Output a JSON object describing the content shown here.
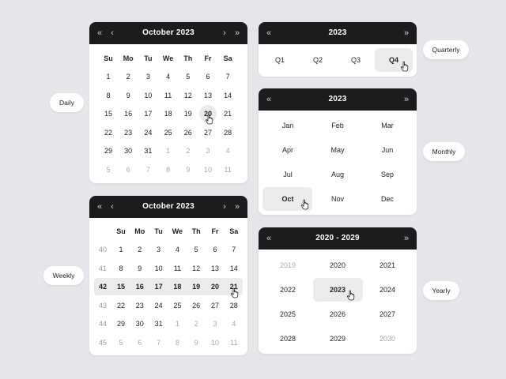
{
  "daily": {
    "title": "October 2023",
    "weekdays": [
      "Su",
      "Mo",
      "Tu",
      "We",
      "Th",
      "Fr",
      "Sa"
    ],
    "rows": [
      [
        {
          "d": "1"
        },
        {
          "d": "2"
        },
        {
          "d": "3"
        },
        {
          "d": "4"
        },
        {
          "d": "5"
        },
        {
          "d": "6"
        },
        {
          "d": "7"
        }
      ],
      [
        {
          "d": "8"
        },
        {
          "d": "9"
        },
        {
          "d": "10"
        },
        {
          "d": "11"
        },
        {
          "d": "12"
        },
        {
          "d": "13"
        },
        {
          "d": "14"
        }
      ],
      [
        {
          "d": "15"
        },
        {
          "d": "16"
        },
        {
          "d": "17"
        },
        {
          "d": "18"
        },
        {
          "d": "19"
        },
        {
          "d": "20",
          "sel": true
        },
        {
          "d": "21"
        }
      ],
      [
        {
          "d": "22"
        },
        {
          "d": "23"
        },
        {
          "d": "24"
        },
        {
          "d": "25"
        },
        {
          "d": "26"
        },
        {
          "d": "27"
        },
        {
          "d": "28"
        }
      ],
      [
        {
          "d": "29"
        },
        {
          "d": "30"
        },
        {
          "d": "31"
        },
        {
          "d": "1",
          "m": true
        },
        {
          "d": "2",
          "m": true
        },
        {
          "d": "3",
          "m": true
        },
        {
          "d": "4",
          "m": true
        }
      ],
      [
        {
          "d": "5",
          "m": true
        },
        {
          "d": "6",
          "m": true
        },
        {
          "d": "7",
          "m": true
        },
        {
          "d": "8",
          "m": true
        },
        {
          "d": "9",
          "m": true
        },
        {
          "d": "10",
          "m": true
        },
        {
          "d": "11",
          "m": true
        }
      ]
    ]
  },
  "weekly": {
    "title": "October 2023",
    "weekdays": [
      "Su",
      "Mo",
      "Tu",
      "We",
      "Th",
      "Fr",
      "Sa"
    ],
    "rows": [
      {
        "wk": "40",
        "days": [
          {
            "d": "1"
          },
          {
            "d": "2"
          },
          {
            "d": "3"
          },
          {
            "d": "4"
          },
          {
            "d": "5"
          },
          {
            "d": "6"
          },
          {
            "d": "7"
          }
        ]
      },
      {
        "wk": "41",
        "days": [
          {
            "d": "8"
          },
          {
            "d": "9"
          },
          {
            "d": "10"
          },
          {
            "d": "11"
          },
          {
            "d": "12"
          },
          {
            "d": "13"
          },
          {
            "d": "14"
          }
        ]
      },
      {
        "wk": "42",
        "sel": true,
        "days": [
          {
            "d": "15"
          },
          {
            "d": "16"
          },
          {
            "d": "17"
          },
          {
            "d": "18"
          },
          {
            "d": "19"
          },
          {
            "d": "20"
          },
          {
            "d": "21"
          }
        ]
      },
      {
        "wk": "43",
        "days": [
          {
            "d": "22"
          },
          {
            "d": "23"
          },
          {
            "d": "24"
          },
          {
            "d": "25"
          },
          {
            "d": "26"
          },
          {
            "d": "27"
          },
          {
            "d": "28"
          }
        ]
      },
      {
        "wk": "44",
        "days": [
          {
            "d": "29"
          },
          {
            "d": "30"
          },
          {
            "d": "31"
          },
          {
            "d": "1",
            "m": true
          },
          {
            "d": "2",
            "m": true
          },
          {
            "d": "3",
            "m": true
          },
          {
            "d": "4",
            "m": true
          }
        ]
      },
      {
        "wk": "45",
        "days": [
          {
            "d": "5",
            "m": true
          },
          {
            "d": "6",
            "m": true
          },
          {
            "d": "7",
            "m": true
          },
          {
            "d": "8",
            "m": true
          },
          {
            "d": "9",
            "m": true
          },
          {
            "d": "10",
            "m": true
          },
          {
            "d": "11",
            "m": true
          }
        ]
      }
    ]
  },
  "quarterly": {
    "title": "2023",
    "quarters": [
      {
        "q": "Q1"
      },
      {
        "q": "Q2"
      },
      {
        "q": "Q3"
      },
      {
        "q": "Q4",
        "sel": true
      }
    ]
  },
  "monthly": {
    "title": "2023",
    "months": [
      {
        "m": "Jan"
      },
      {
        "m": "Feb"
      },
      {
        "m": "Mar"
      },
      {
        "m": "Apr"
      },
      {
        "m": "May"
      },
      {
        "m": "Jun"
      },
      {
        "m": "Jul"
      },
      {
        "m": "Aug"
      },
      {
        "m": "Sep"
      },
      {
        "m": "Oct",
        "sel": true
      },
      {
        "m": "Nov"
      },
      {
        "m": "Dec"
      }
    ]
  },
  "yearly": {
    "title": "2020 - 2029",
    "years": [
      {
        "y": "2019",
        "m": true
      },
      {
        "y": "2020"
      },
      {
        "y": "2021"
      },
      {
        "y": "2022"
      },
      {
        "y": "2023",
        "sel": true
      },
      {
        "y": "2024"
      },
      {
        "y": "2025"
      },
      {
        "y": "2026"
      },
      {
        "y": "2027"
      },
      {
        "y": "2028"
      },
      {
        "y": "2029"
      },
      {
        "y": "2030",
        "m": true
      }
    ]
  },
  "labels": {
    "daily": "Daily",
    "weekly": "Weekly",
    "quarterly": "Quarterly",
    "monthly": "Monthly",
    "yearly": "Yearly"
  },
  "icons": {
    "prev_year": "double-chevron-left-icon",
    "prev_month": "chevron-left-icon",
    "next_month": "chevron-right-icon",
    "next_year": "double-chevron-right-icon",
    "cursor": "hand-pointer-icon"
  },
  "colors": {
    "header_bg": "#1c1c1e",
    "selected_bg": "#ebebeb",
    "page_bg": "#e4e6ea"
  }
}
